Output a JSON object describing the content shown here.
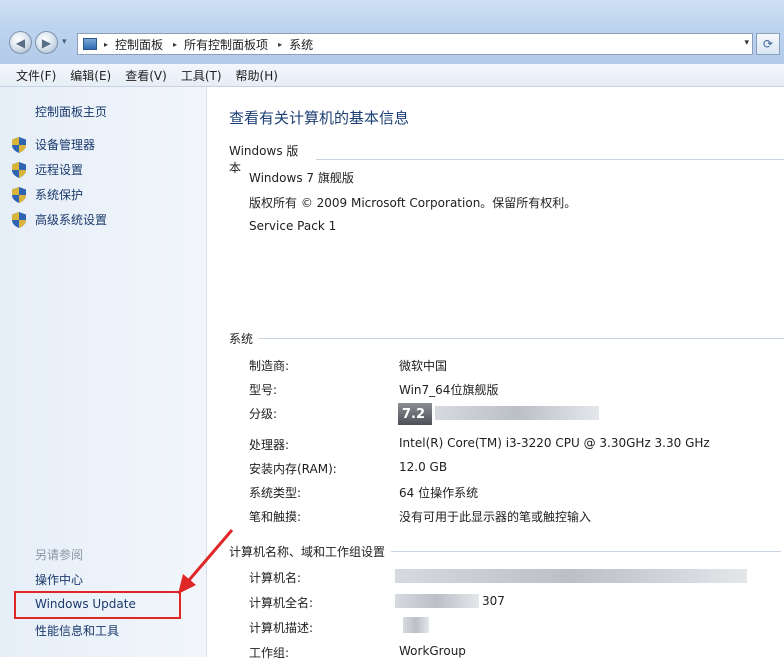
{
  "nav": {
    "back_glyph": "◀",
    "forward_glyph": "▶",
    "history_glyph": "▾",
    "address_crumbs": [
      "控制面板",
      "所有控制面板项",
      "系统"
    ],
    "crumb_separator": "▸",
    "address_drop_glyph": "▾",
    "refresh_glyph": "⟳"
  },
  "menu": [
    "文件(F)",
    "编辑(E)",
    "查看(V)",
    "工具(T)",
    "帮助(H)"
  ],
  "left": {
    "home": "控制面板主页",
    "tasks": [
      "设备管理器",
      "远程设置",
      "系统保护",
      "高级系统设置"
    ],
    "see_also_title": "另请参阅",
    "see_also": [
      "操作中心",
      "Windows Update",
      "性能信息和工具"
    ]
  },
  "main": {
    "title": "查看有关计算机的基本信息",
    "windows_section": {
      "heading": "Windows 版本",
      "edition": "Windows 7 旗舰版",
      "copyright": "版权所有 © 2009 Microsoft Corporation。保留所有权利。",
      "service_pack": "Service Pack 1"
    },
    "system_section": {
      "heading": "系统",
      "rows": [
        {
          "label": "制造商:",
          "value": "微软中国"
        },
        {
          "label": "型号:",
          "value": "Win7_64位旗舰版"
        },
        {
          "label": "分级:",
          "value": "7.2"
        },
        {
          "label": "处理器:",
          "value": "Intel(R) Core(TM) i3-3220 CPU @ 3.30GHz   3.30 GHz"
        },
        {
          "label": "安装内存(RAM):",
          "value": "12.0 GB"
        },
        {
          "label": "系统类型:",
          "value": "64 位操作系统"
        },
        {
          "label": "笔和触摸:",
          "value": "没有可用于此显示器的笔或触控输入"
        }
      ]
    },
    "computer_section": {
      "heading": "计算机名称、域和工作组设置",
      "rows": [
        {
          "label": "计算机名:",
          "value": ""
        },
        {
          "label": "计算机全名:",
          "value": "307"
        },
        {
          "label": "计算机描述:",
          "value": ""
        },
        {
          "label": "工作组:",
          "value": "WorkGroup"
        }
      ]
    }
  },
  "colors": {
    "link": "#1a3a6b",
    "title": "#1c3f73",
    "annotation": "#e02727"
  }
}
